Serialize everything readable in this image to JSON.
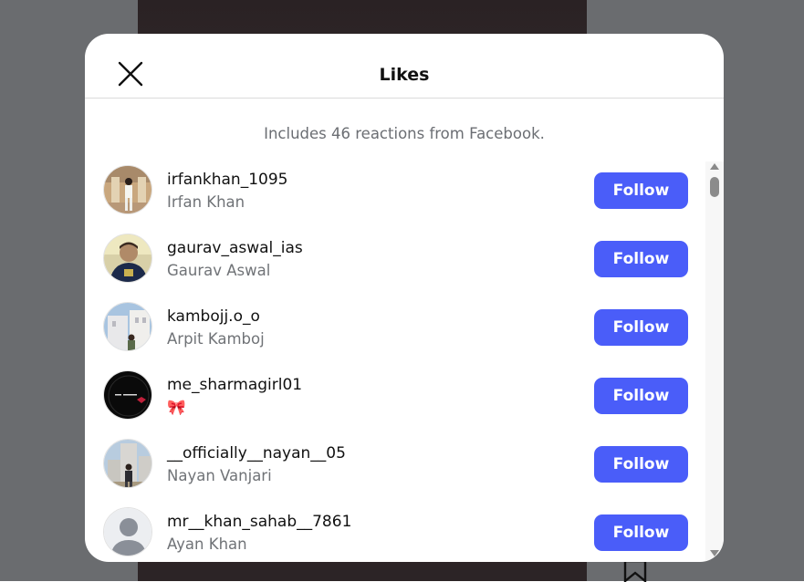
{
  "modal": {
    "title": "Likes",
    "info": "Includes 46 reactions from Facebook."
  },
  "icons": {
    "close": "close-icon",
    "bookmark": "bookmark-icon"
  },
  "colors": {
    "follow_button": "#4a5df9",
    "backdrop": "#6a6c6f"
  },
  "users": [
    {
      "username": "irfankhan_1095",
      "fullname": "Irfan Khan",
      "button": "Follow"
    },
    {
      "username": "gaurav_aswal_ias",
      "fullname": "Gaurav Aswal",
      "button": "Follow"
    },
    {
      "username": "kambojj.o_o",
      "fullname": "Arpit Kamboj",
      "button": "Follow"
    },
    {
      "username": "me_sharmagirl01",
      "fullname": "🎀",
      "button": "Follow"
    },
    {
      "username": "__officially__nayan__05",
      "fullname": "Nayan Vanjari",
      "button": "Follow"
    },
    {
      "username": "mr__khan_sahab__7861",
      "fullname": "Ayan Khan",
      "button": "Follow"
    }
  ]
}
